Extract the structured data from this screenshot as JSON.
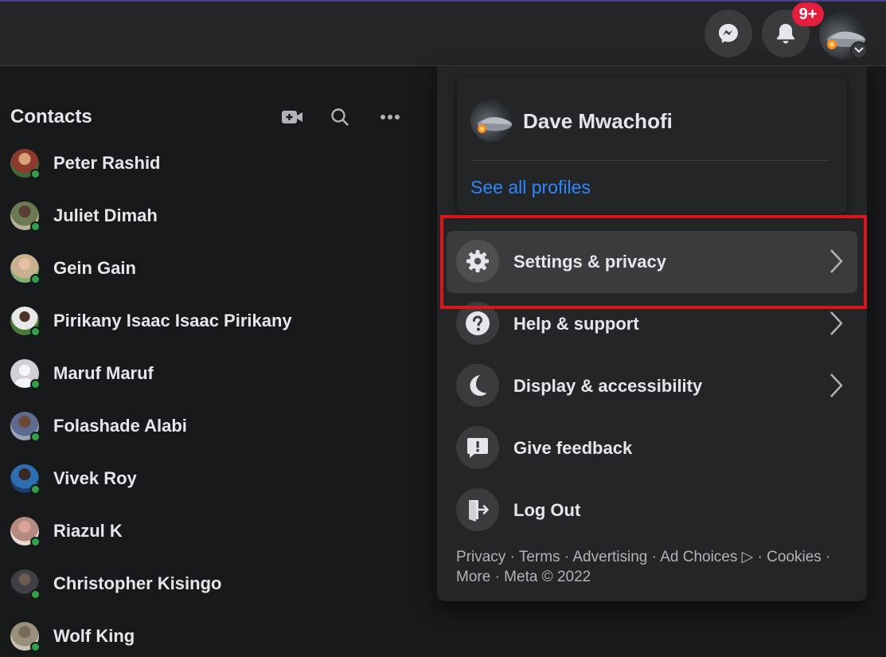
{
  "header": {
    "notifications_badge": "9+"
  },
  "contacts": {
    "title": "Contacts",
    "list": [
      {
        "name": "Peter Rashid",
        "avatar_color": "#8a3b2c"
      },
      {
        "name": "Juliet Dimah",
        "avatar_color": "#6b7a52"
      },
      {
        "name": "Gein Gain",
        "avatar_color": "#c9b18f"
      },
      {
        "name": "Pirikany Isaac Isaac Pirikany",
        "avatar_color": "#4a7a3a"
      },
      {
        "name": "Maruf Maruf",
        "avatar_color": "#cfd1d5"
      },
      {
        "name": "Folashade Alabi",
        "avatar_color": "#5d6b8f"
      },
      {
        "name": "Vivek Roy",
        "avatar_color": "#2d6fb0"
      },
      {
        "name": "Riazul K",
        "avatar_color": "#b58a80"
      },
      {
        "name": "Christopher Kisingo",
        "avatar_color": "#3f3f44"
      },
      {
        "name": "Wolf King",
        "avatar_color": "#9a8f7a"
      }
    ]
  },
  "account_menu": {
    "profile_name": "Dave Mwachofi",
    "see_all_profiles": "See all profiles",
    "items": [
      {
        "label": "Settings & privacy",
        "icon": "gear-icon",
        "has_chevron": true,
        "highlighted": true
      },
      {
        "label": "Help & support",
        "icon": "question-icon",
        "has_chevron": true,
        "highlighted": false
      },
      {
        "label": "Display & accessibility",
        "icon": "moon-icon",
        "has_chevron": true,
        "highlighted": false
      },
      {
        "label": "Give feedback",
        "icon": "feedback-icon",
        "has_chevron": false,
        "highlighted": false
      },
      {
        "label": "Log Out",
        "icon": "logout-icon",
        "has_chevron": false,
        "highlighted": false
      }
    ],
    "footer": {
      "line1": "Privacy · Terms · Advertising · Ad Choices ▷ · Cookies ·",
      "line2": "More · Meta © 2022"
    }
  },
  "colors": {
    "background": "#18191a",
    "surface": "#242526",
    "link": "#2d88ff",
    "badge": "#e41e3f",
    "online": "#31a24c",
    "highlight": "#e0131d"
  }
}
